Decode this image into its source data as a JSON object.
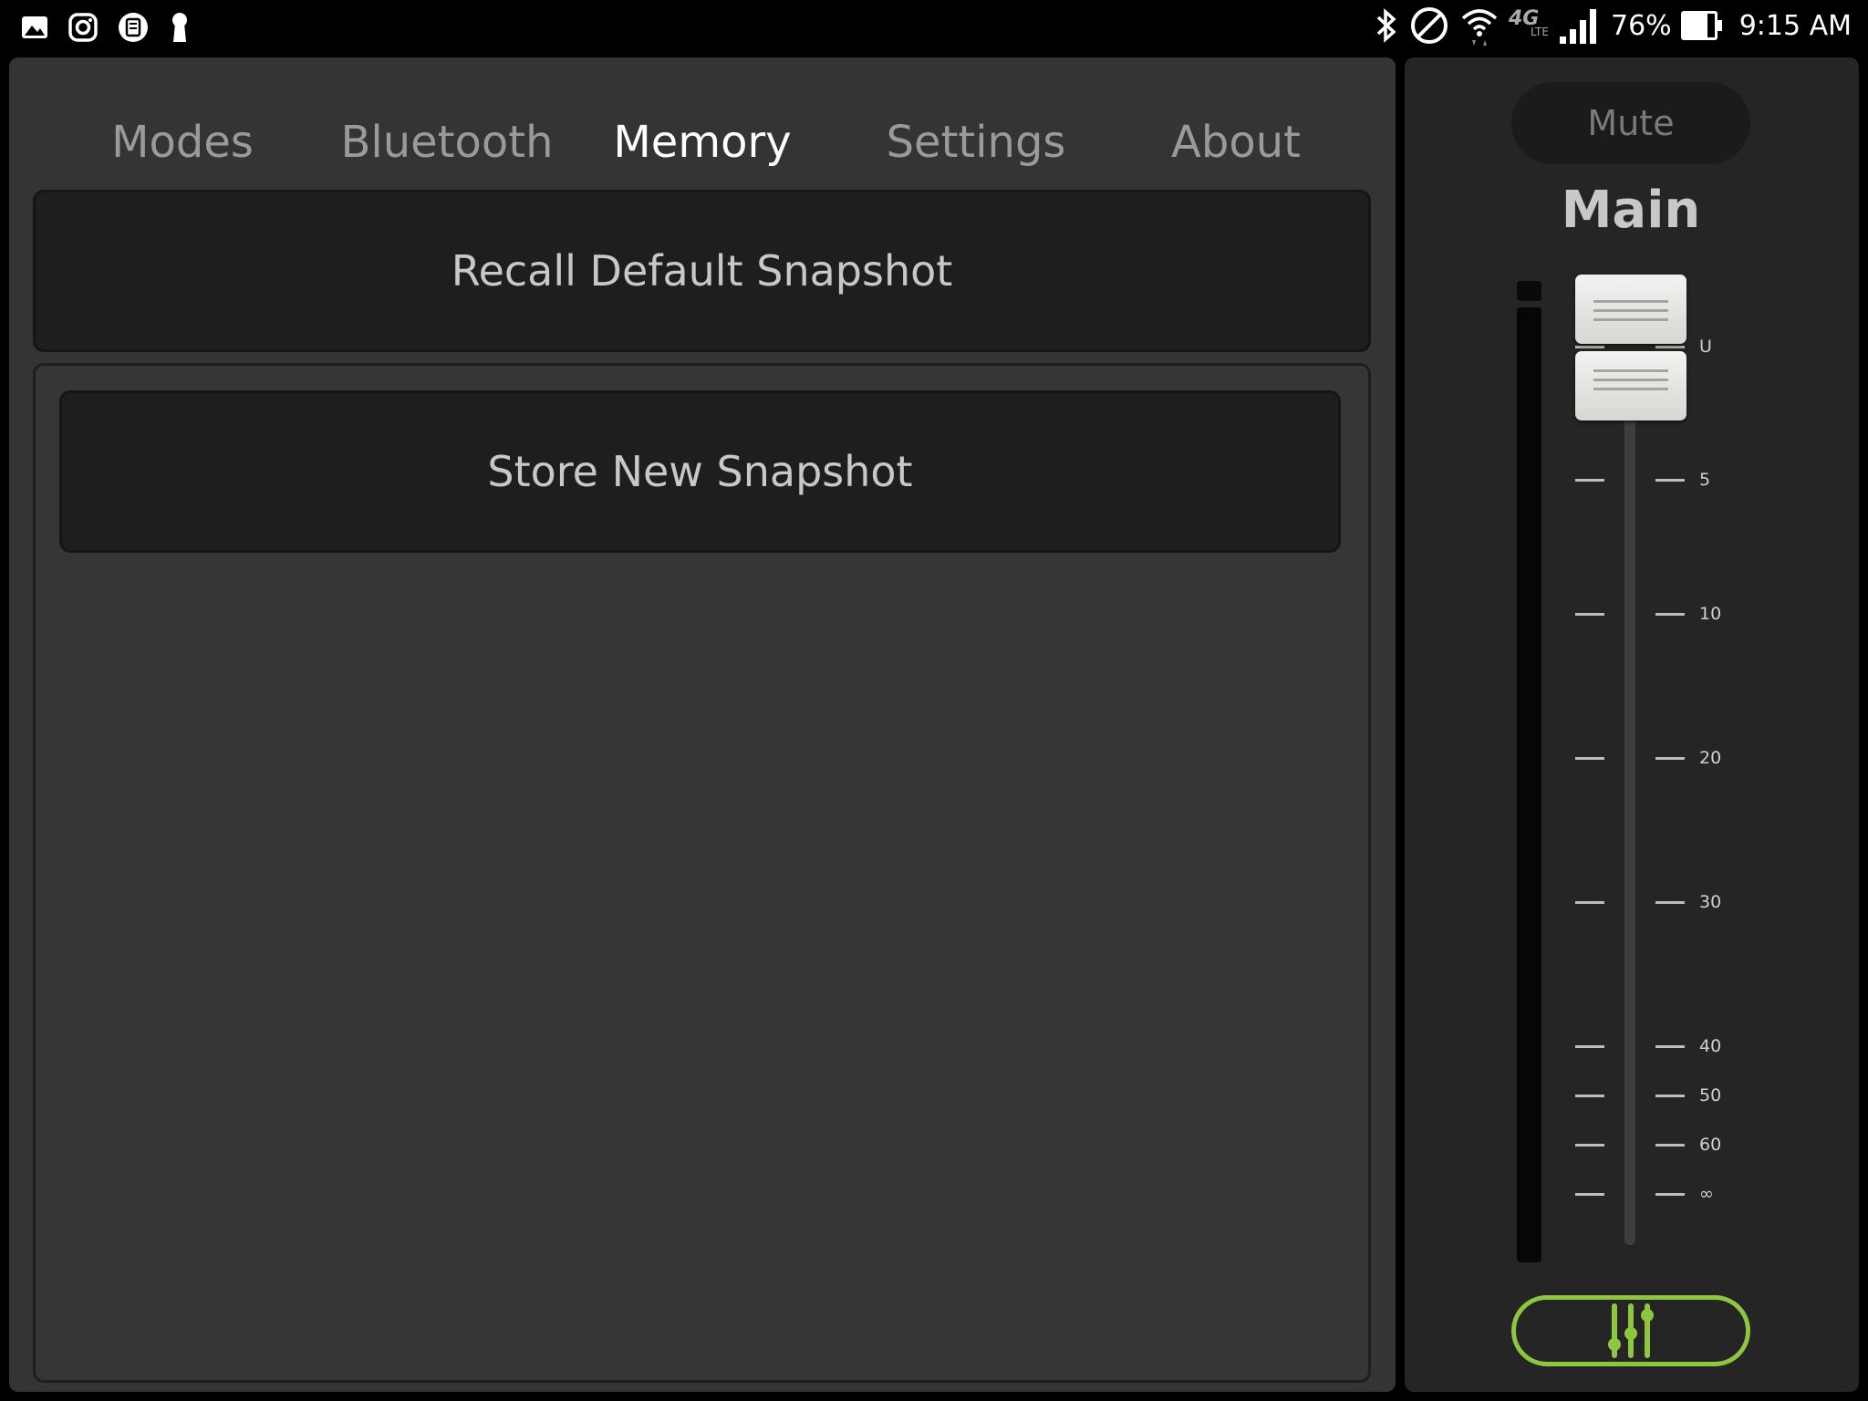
{
  "status_bar": {
    "left_icons": [
      "gallery-icon",
      "instagram-icon",
      "app-icon",
      "keyhole-icon"
    ],
    "network_type": "4G",
    "network_sub": "LTE",
    "battery_percent": "76%",
    "battery_level": 0.76,
    "time": "9:15 AM"
  },
  "tabs": [
    {
      "label": "Modes"
    },
    {
      "label": "Bluetooth"
    },
    {
      "label": "Memory"
    },
    {
      "label": "Settings"
    },
    {
      "label": "About"
    }
  ],
  "active_tab": "Memory",
  "memory": {
    "recall_default_label": "Recall Default Snapshot",
    "store_new_label": "Store New Snapshot"
  },
  "fader": {
    "mute_label": "Mute",
    "channel_name": "Main",
    "scale_labels": [
      "U",
      "5",
      "10",
      "20",
      "30",
      "40",
      "50",
      "60",
      "∞"
    ]
  },
  "colors": {
    "accent_green": "#7ac943",
    "panel_bg": "#343434",
    "button_bg": "#1e1e1e"
  }
}
